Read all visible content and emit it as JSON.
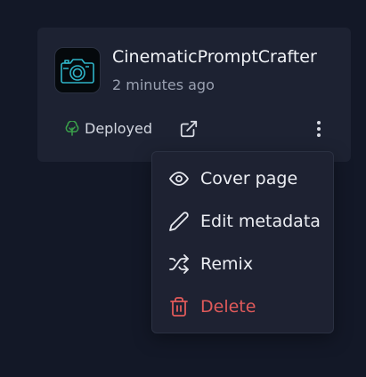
{
  "app": {
    "name": "CinematicPromptCrafter",
    "updated": "2 minutes ago",
    "status": "Deployed",
    "icon": "camera-icon",
    "accent": "#2fb4c8",
    "status_color": "#3aa04a"
  },
  "menu": {
    "items": [
      {
        "label": "Cover page",
        "icon": "eye-icon"
      },
      {
        "label": "Edit metadata",
        "icon": "pencil-icon"
      },
      {
        "label": "Remix",
        "icon": "shuffle-icon"
      },
      {
        "label": "Delete",
        "icon": "trash-icon",
        "color": "#e05a5a"
      }
    ]
  }
}
